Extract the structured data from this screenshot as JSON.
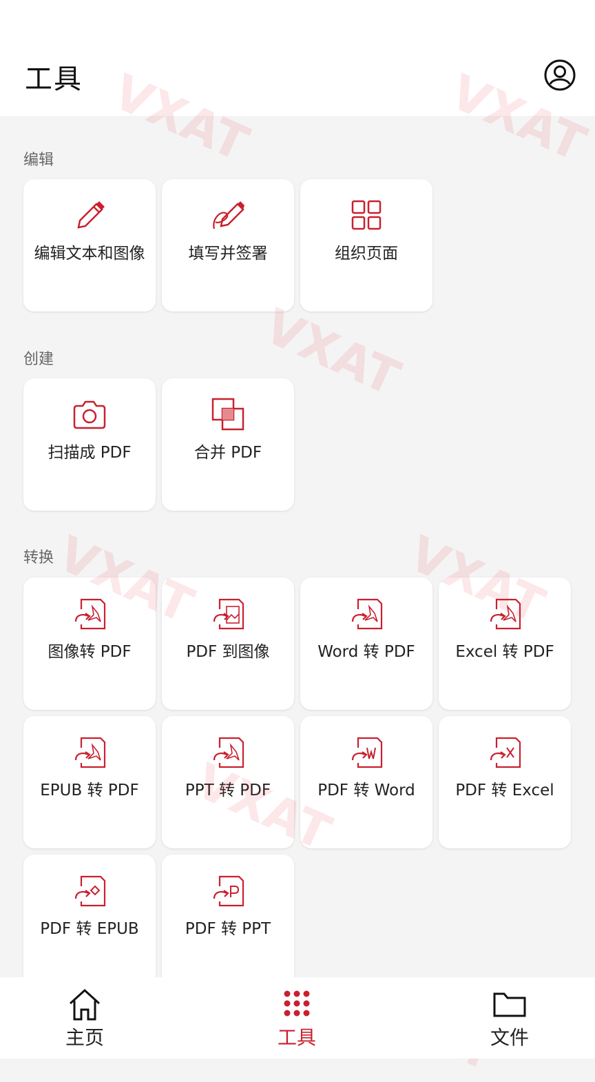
{
  "header": {
    "title": "工具"
  },
  "sections": [
    {
      "label": "编辑"
    },
    {
      "label": "创建"
    },
    {
      "label": "转换"
    }
  ],
  "tools": {
    "edit_text_image": "编辑文本和图像",
    "fill_sign": "填写并签署",
    "organize_pages": "组织页面",
    "scan_to_pdf": "扫描成 PDF",
    "merge_pdf": "合并 PDF",
    "image_to_pdf": "图像转 PDF",
    "pdf_to_image": "PDF 到图像",
    "word_to_pdf": "Word 转 PDF",
    "excel_to_pdf": "Excel 转 PDF",
    "epub_to_pdf": "EPUB 转 PDF",
    "ppt_to_pdf": "PPT 转 PDF",
    "pdf_to_word": "PDF 转 Word",
    "pdf_to_excel": "PDF 转 Excel",
    "pdf_to_epub": "PDF 转 EPUB",
    "pdf_to_ppt": "PDF 转 PPT"
  },
  "nav": {
    "home": "主页",
    "tools": "工具",
    "files": "文件"
  },
  "watermark": {
    "text": "VXAT"
  },
  "colors": {
    "accent": "#c8202f",
    "background": "#f4f4f4"
  }
}
